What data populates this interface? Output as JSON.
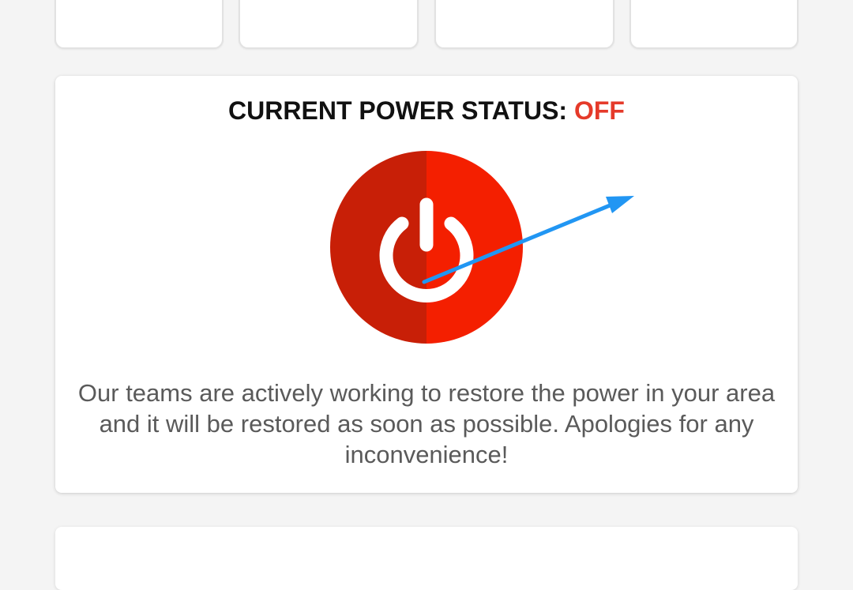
{
  "status": {
    "heading_label": "CURRENT POWER STATUS:",
    "heading_value": "OFF",
    "value_color": "#e53a2a",
    "icon": "power-icon",
    "annotation_icon": "arrow-icon",
    "message": "Our teams are actively working to restore the power in your area and it will be restored as soon as possible. Apologies for any inconvenience!"
  },
  "colors": {
    "power_left": "#c81f07",
    "power_right": "#f41f00",
    "arrow": "#2196f3"
  }
}
